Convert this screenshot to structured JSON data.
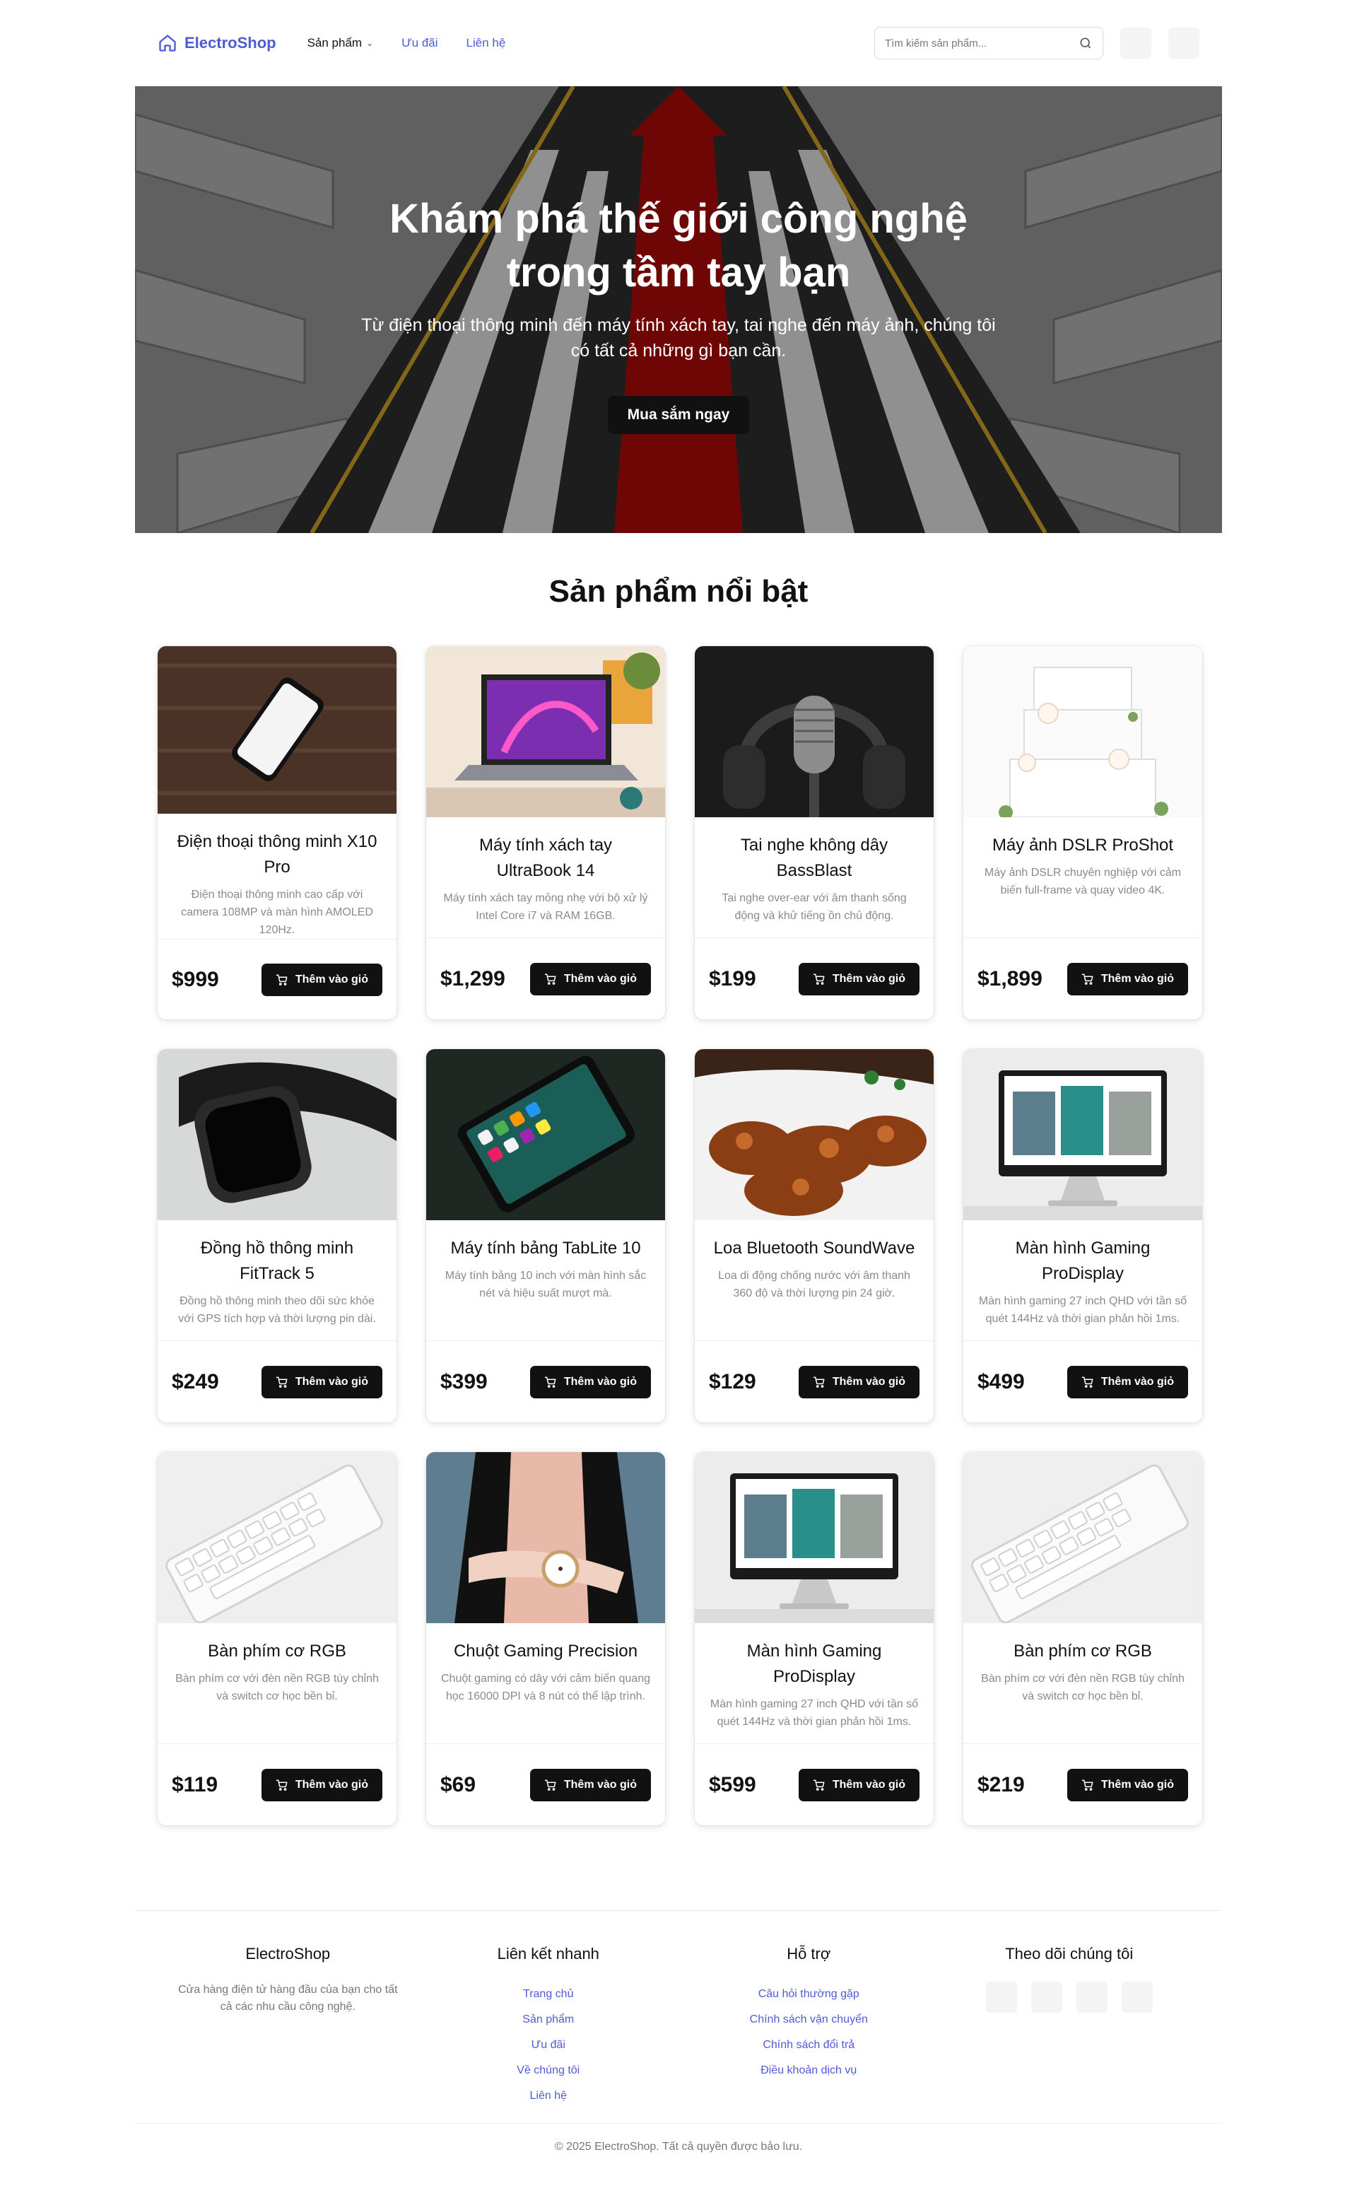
{
  "brand": {
    "name": "ElectroShop",
    "color": "#4f5bd5"
  },
  "nav": {
    "products": "Sản phẩm",
    "deals": "Ưu đãi",
    "contact": "Liên hệ"
  },
  "search": {
    "placeholder": "Tìm kiếm sản phẩm..."
  },
  "hero": {
    "title": "Khám phá thế giới công nghệ trong tầm tay bạn",
    "subtitle": "Từ điện thoại thông minh đến máy tính xách tay, tai nghe đến máy ảnh, chúng tôi có tất cả những gì bạn cần.",
    "cta": "Mua sắm ngay"
  },
  "featured": {
    "title": "Sản phẩm nổi bật",
    "add_label": "Thêm vào giỏ",
    "products": [
      {
        "name": "Điện thoại thông minh X10 Pro",
        "desc": "Điện thoại thông minh cao cấp với camera 108MP và màn hình AMOLED 120Hz.",
        "price": "$999",
        "image": "phone-on-wood"
      },
      {
        "name": "Máy tính xách tay UltraBook 14",
        "desc": "Máy tính xách tay mỏng nhẹ với bộ xử lý Intel Core i7 và RAM 16GB.",
        "price": "$1,299",
        "image": "laptop-on-desk"
      },
      {
        "name": "Tai nghe không dây BassBlast",
        "desc": "Tai nghe over-ear với âm thanh sống động và khử tiếng ồn chủ động.",
        "price": "$199",
        "image": "headphones-microphone"
      },
      {
        "name": "Máy ảnh DSLR ProShot",
        "desc": "Máy ảnh DSLR chuyên nghiệp với cảm biến full-frame và quay video 4K.",
        "price": "$1,899",
        "image": "wedding-cake"
      },
      {
        "name": "Đồng hồ thông minh FitTrack 5",
        "desc": "Đồng hồ thông minh theo dõi sức khỏe với GPS tích hợp và thời lượng pin dài.",
        "price": "$249",
        "image": "smartwatch"
      },
      {
        "name": "Máy tính bảng TabLite 10",
        "desc": "Máy tính bảng 10 inch với màn hình sắc nét và hiệu suất mượt mà.",
        "price": "$399",
        "image": "tablet"
      },
      {
        "name": "Loa Bluetooth SoundWave",
        "desc": "Loa di động chống nước với âm thanh 360 độ và thời lượng pin 24 giờ.",
        "price": "$129",
        "image": "grilled-food"
      },
      {
        "name": "Màn hình Gaming ProDisplay",
        "desc": "Màn hình gaming 27 inch QHD với tần số quét 144Hz và thời gian phản hồi 1ms.",
        "price": "$499",
        "image": "monitor-imac"
      },
      {
        "name": "Bàn phím cơ RGB",
        "desc": "Bàn phím cơ với đèn nền RGB tùy chỉnh và switch cơ học bền bỉ.",
        "price": "$119",
        "image": "white-keyboard"
      },
      {
        "name": "Chuột Gaming Precision",
        "desc": "Chuột gaming có dây với cảm biến quang học 16000 DPI và 8 nút có thể lập trình.",
        "price": "$69",
        "image": "woman-watch"
      },
      {
        "name": "Màn hình Gaming ProDisplay",
        "desc": "Màn hình gaming 27 inch QHD với tần số quét 144Hz và thời gian phản hồi 1ms.",
        "price": "$599",
        "image": "monitor-imac"
      },
      {
        "name": "Bàn phím cơ RGB",
        "desc": "Bàn phím cơ với đèn nền RGB tùy chỉnh và switch cơ học bền bỉ.",
        "price": "$219",
        "image": "white-keyboard"
      }
    ]
  },
  "footer": {
    "brand_title": "ElectroShop",
    "brand_text": "Cửa hàng điện tử hàng đầu của bạn cho tất cả các nhu cầu công nghệ.",
    "quick_links_title": "Liên kết nhanh",
    "quick_links": [
      "Trang chủ",
      "Sản phẩm",
      "Ưu đãi",
      "Về chúng tôi",
      "Liên hệ"
    ],
    "support_title": "Hỗ trợ",
    "support_links": [
      "Câu hỏi thường gặp",
      "Chính sách vận chuyển",
      "Chính sách đổi trả",
      "Điều khoản dịch vụ"
    ],
    "follow_title": "Theo dõi chúng tôi",
    "copyright": "© 2025 ElectroShop. Tất cả quyền được bảo lưu."
  }
}
